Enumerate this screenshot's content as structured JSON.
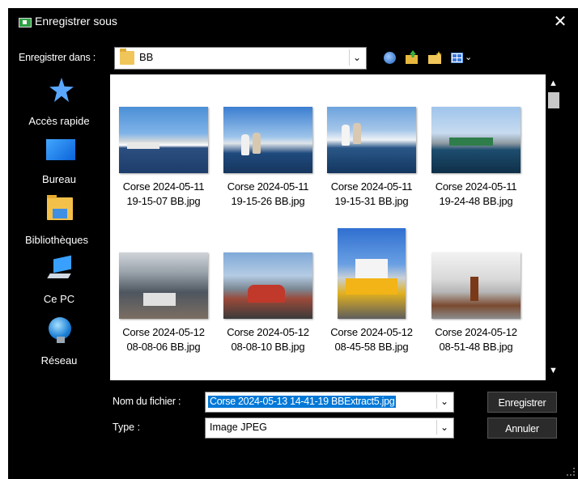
{
  "window": {
    "title": "Enregistrer sous",
    "close_glyph": "✕"
  },
  "save_in": {
    "label": "Enregistrer dans :",
    "value": "BB"
  },
  "toolbar": {
    "icons": [
      "back-globe-icon",
      "up-folder-icon",
      "new-folder-icon",
      "view-menu-icon"
    ],
    "view_caret": "⌄"
  },
  "places": [
    {
      "label": "Accès rapide",
      "icon": "star-icon"
    },
    {
      "label": "Bureau",
      "icon": "desktop-icon"
    },
    {
      "label": "Bibliothèques",
      "icon": "libraries-icon"
    },
    {
      "label": "Ce PC",
      "icon": "computer-icon"
    },
    {
      "label": "Réseau",
      "icon": "network-icon"
    }
  ],
  "files": [
    {
      "line1": "Corse 2024-05-11",
      "line2": "19-15-07 BB.jpg"
    },
    {
      "line1": "Corse 2024-05-11",
      "line2": "19-15-26 BB.jpg"
    },
    {
      "line1": "Corse 2024-05-11",
      "line2": "19-15-31 BB.jpg"
    },
    {
      "line1": "Corse 2024-05-11",
      "line2": "19-24-48 BB.jpg"
    },
    {
      "line1": "Corse 2024-05-12",
      "line2": "08-08-06 BB.jpg"
    },
    {
      "line1": "Corse 2024-05-12",
      "line2": "08-08-10 BB.jpg"
    },
    {
      "line1": "Corse 2024-05-12",
      "line2": "08-45-58 BB.jpg"
    },
    {
      "line1": "Corse 2024-05-12",
      "line2": "08-51-48 BB.jpg"
    }
  ],
  "filename": {
    "label": "Nom du fichier :",
    "value": "Corse 2024-05-13 14-41-19 BBExtract5.jpg"
  },
  "filetype": {
    "label": "Type :",
    "value": "Image JPEG"
  },
  "buttons": {
    "save": "Enregistrer",
    "cancel": "Annuler"
  },
  "scrollbar": {
    "up": "▲",
    "down": "▼"
  },
  "colors": {
    "dialog_bg": "#000000",
    "selection": "#0078d7",
    "list_bg": "#ffffff",
    "button_bg": "#2b2b2b"
  }
}
